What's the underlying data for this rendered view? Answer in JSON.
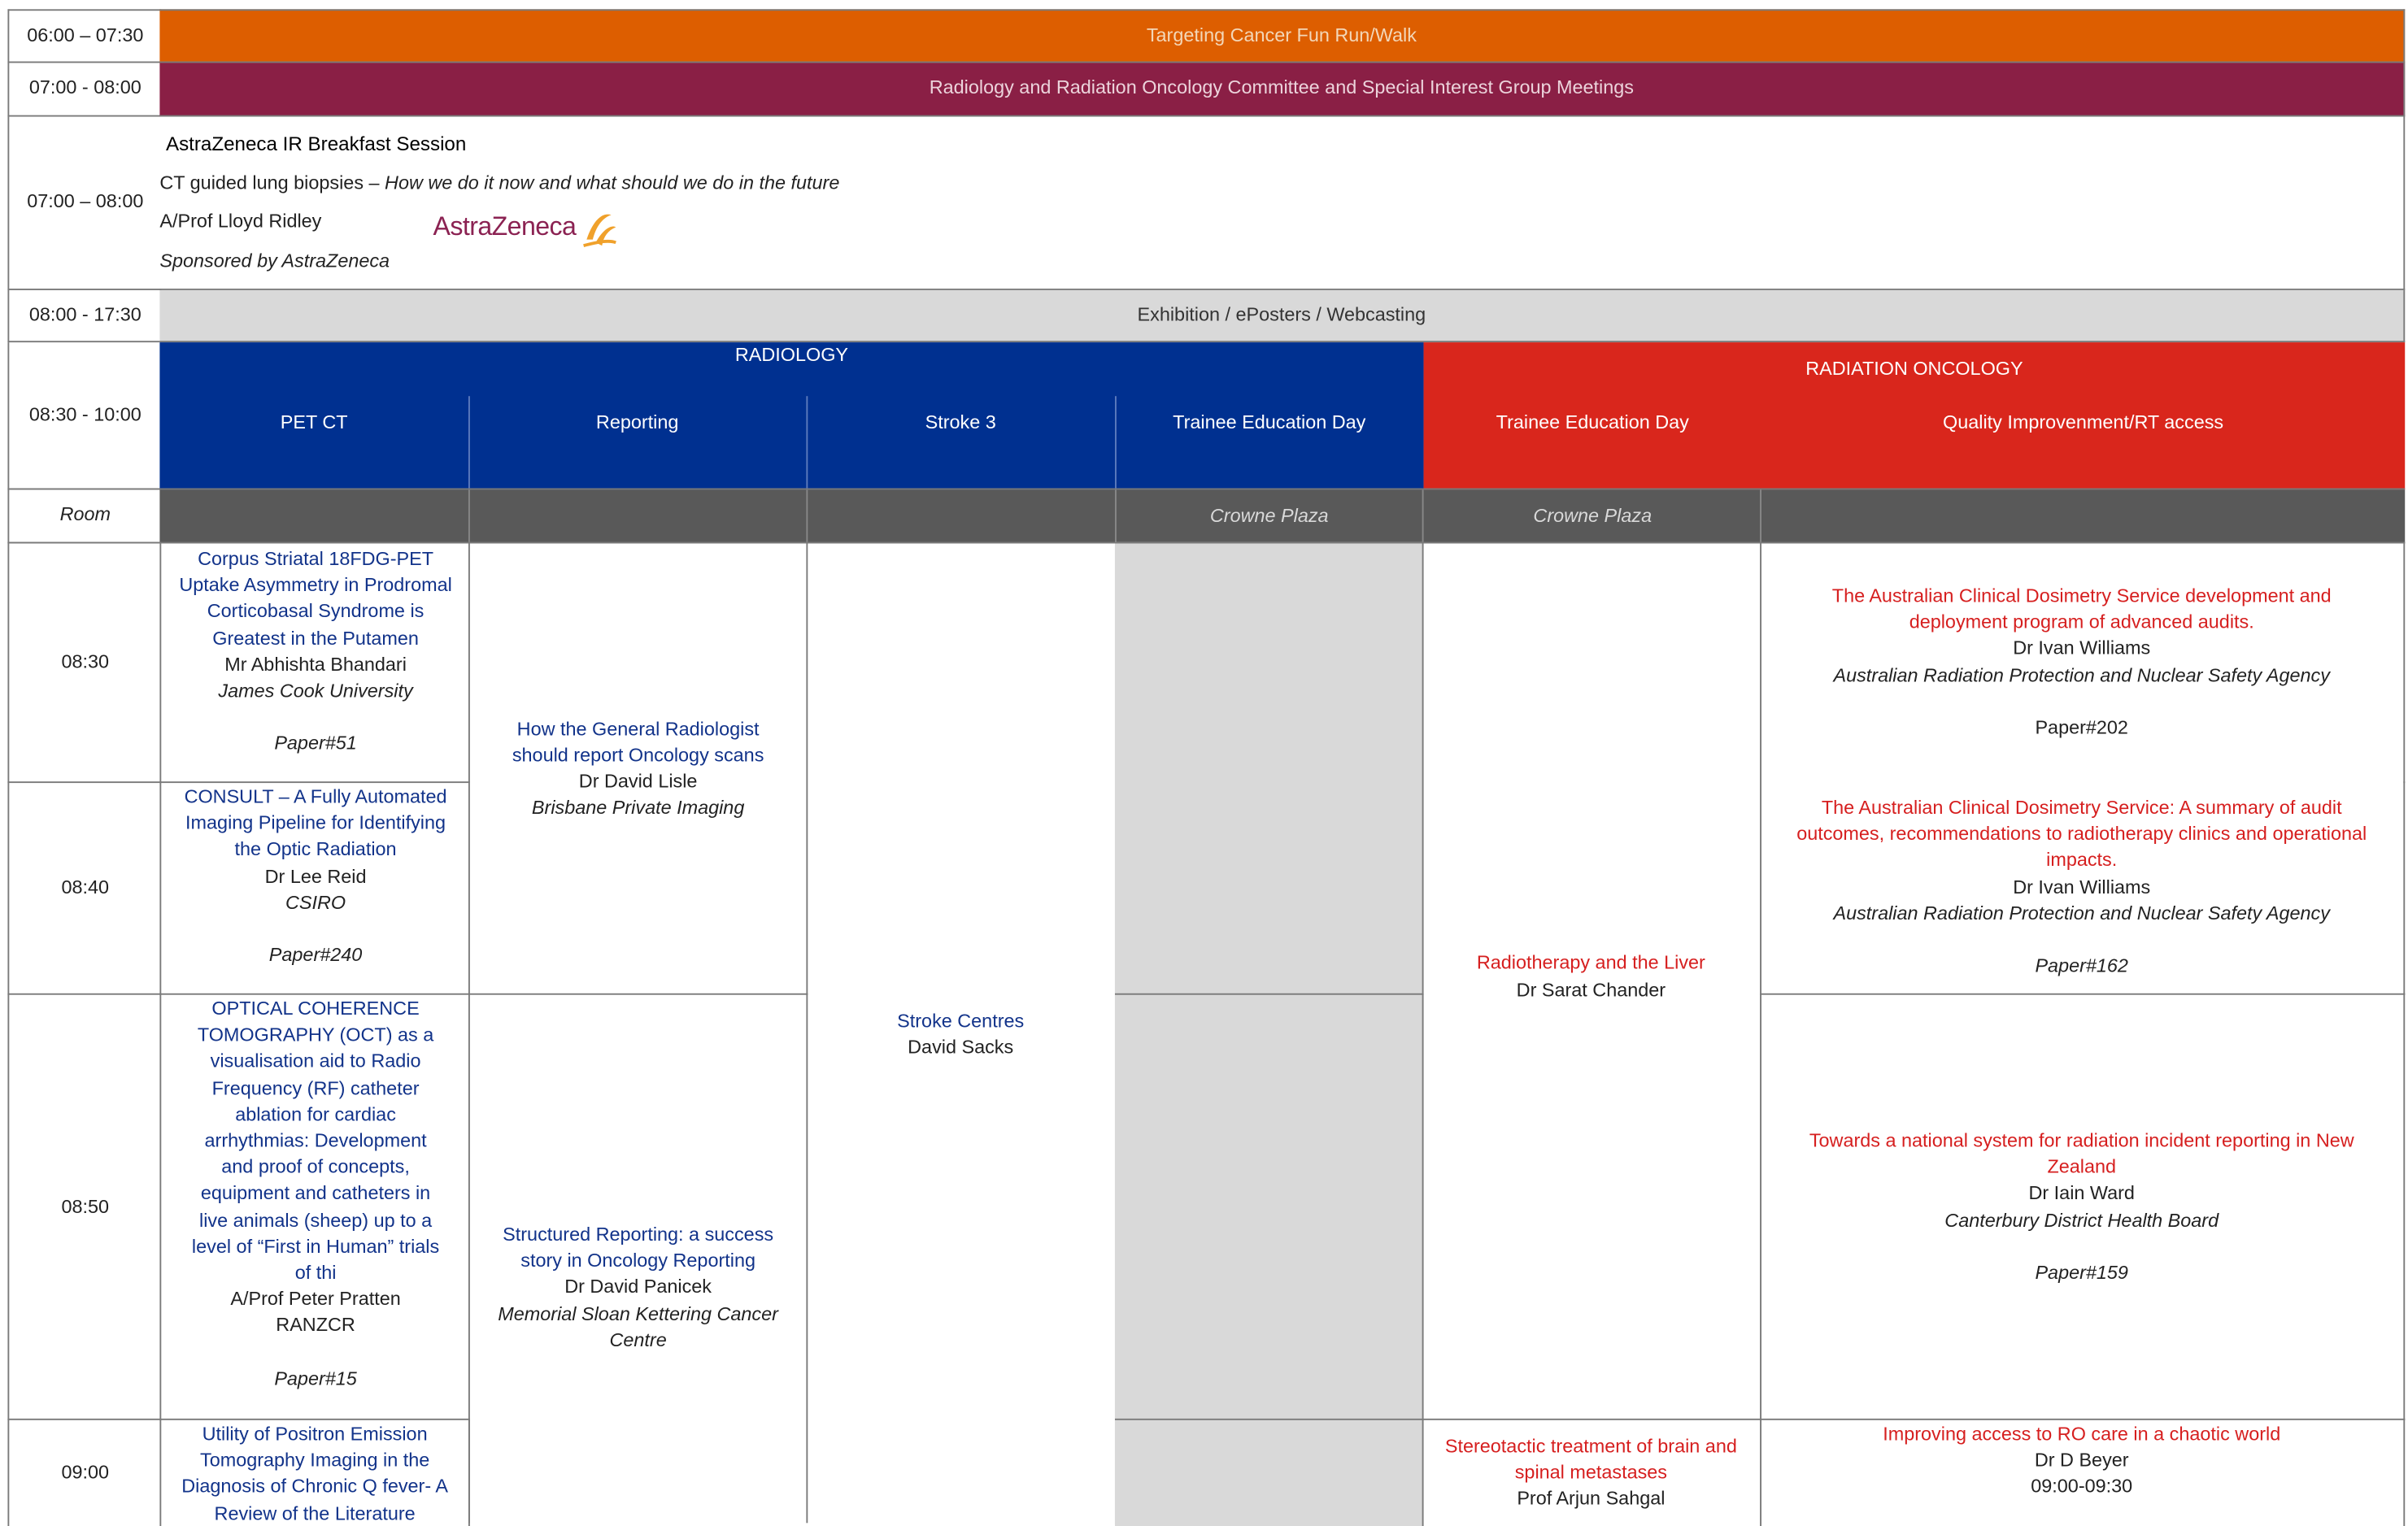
{
  "rows": {
    "run": {
      "time": "06:00 – 07:30",
      "title": "Targeting Cancer Fun Run/Walk"
    },
    "meetings": {
      "time": "07:00 - 08:00",
      "title": "Radiology and Radiation Oncology Committee and Special Interest Group Meetings"
    },
    "breakfast": {
      "time": "07:00 – 08:00",
      "title": "AstraZeneca IR Breakfast Session",
      "topic_plain": "CT guided lung biopsies – ",
      "topic_italic": "How we do it now and what should we do in the future",
      "speaker": "A/Prof Lloyd Ridley",
      "sponsor": "Sponsored by AstraZeneca",
      "logo_text": "AstraZeneca"
    },
    "exhibition": {
      "time": "08:00 - 17:30",
      "title": "Exhibition / ePosters / Webcasting"
    },
    "streams": {
      "time": "08:30 - 10:00",
      "radiology": "RADIOLOGY",
      "radiation_oncology": "RADIATION ONCOLOGY",
      "tracks": [
        "PET CT",
        "Reporting",
        "Stroke 3",
        "Trainee Education Day",
        "Trainee Education Day",
        "Quality Improvenment/RT access"
      ]
    },
    "room": {
      "label": "Room",
      "trainee_rad": "Crowne Plaza",
      "trainee_ro": "Crowne Plaza"
    }
  },
  "times": [
    "08:30",
    "08:40",
    "08:50",
    "09:00"
  ],
  "pet": [
    {
      "title": "Corpus Striatal 18FDG-PET Uptake Asymmetry in Prodromal Corticobasal Syndrome is Greatest in the Putamen",
      "speaker": "Mr Abhishta Bhandari",
      "affil": "James Cook University",
      "paper": "Paper#51"
    },
    {
      "title": "CONSULT – A Fully Automated Imaging Pipeline for Identifying the Optic Radiation",
      "speaker": "Dr Lee Reid",
      "affil": "CSIRO",
      "paper": "Paper#240"
    },
    {
      "title": "OPTICAL COHERENCE TOMOGRAPHY (OCT) as a visualisation aid to Radio Frequency (RF) catheter ablation for cardiac arrhythmias: Development and proof of concepts, equipment and catheters in live animals (sheep) up to a level of “First in Human” trials of thi",
      "speaker": "A/Prof Peter Pratten",
      "affil": "RANZCR",
      "paper": "Paper#15"
    },
    {
      "title": "Utility of Positron Emission Tomography Imaging in the Diagnosis of Chronic Q fever-  A Review of the Literature"
    }
  ],
  "reporting": [
    {
      "title": "How the General Radiologist should report Oncology scans",
      "speaker": "Dr David Lisle",
      "affil": "Brisbane Private Imaging"
    },
    {
      "title": "Structured Reporting: a success story in Oncology Reporting",
      "speaker": "Dr David Panicek",
      "affil": "Memorial Sloan Kettering Cancer Centre"
    }
  ],
  "stroke": {
    "title": "Stroke Centres",
    "speaker": "David Sacks"
  },
  "trainee_ro": [
    {
      "title": "Radiotherapy and the Liver",
      "speaker": "Dr Sarat Chander"
    },
    {
      "title": "Stereotactic treatment of brain and spinal metastases",
      "speaker": "Prof Arjun Sahgal"
    }
  ],
  "quality": [
    {
      "title": "The Australian Clinical Dosimetry Service development and deployment program of advanced audits.",
      "speaker": "Dr Ivan Williams",
      "affil": "Australian Radiation Protection and Nuclear Safety Agency",
      "paper": "Paper#202"
    },
    {
      "title": "The Australian Clinical Dosimetry Service: A summary of audit outcomes, recommendations to radiotherapy clinics and operational impacts.",
      "speaker": "Dr Ivan Williams",
      "affil": "Australian Radiation Protection and Nuclear Safety Agency",
      "paper": "Paper#162"
    },
    {
      "title": "Towards a national system for radiation incident reporting in New Zealand",
      "speaker": "Dr Iain Ward",
      "affil": "Canterbury District Health Board",
      "paper": "Paper#159"
    },
    {
      "title": "Improving access to RO care in a chaotic world",
      "speaker": "Dr D Beyer",
      "time": "09:00-09:30"
    }
  ],
  "colors": {
    "orange": "#dd5e00",
    "maroon": "#8a1f45",
    "blue": "#003090",
    "red": "#d9261c",
    "grey": "#d9d9d9",
    "dark": "#595959"
  }
}
